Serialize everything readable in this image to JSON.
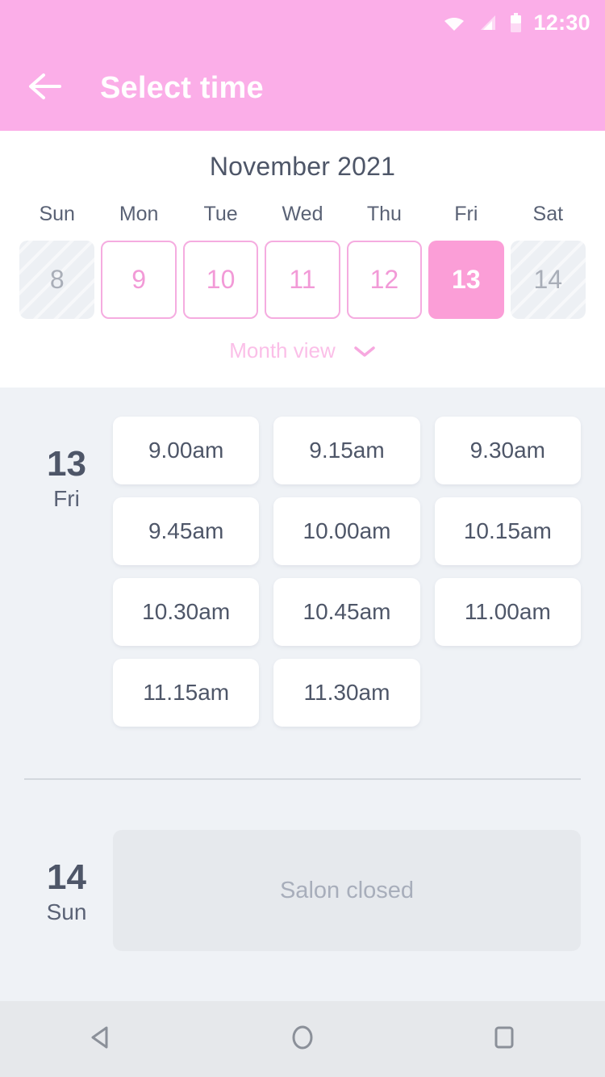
{
  "status_bar": {
    "time": "12:30",
    "icons": [
      "wifi-icon",
      "signal-icon",
      "battery-icon"
    ]
  },
  "app_bar": {
    "title": "Select time",
    "back_icon": "back-arrow-icon"
  },
  "calendar": {
    "month_title": "November 2021",
    "day_names": [
      "Sun",
      "Mon",
      "Tue",
      "Wed",
      "Thu",
      "Fri",
      "Sat"
    ],
    "dates": [
      {
        "day": "8",
        "state": "disabled"
      },
      {
        "day": "9",
        "state": "enabled"
      },
      {
        "day": "10",
        "state": "enabled"
      },
      {
        "day": "11",
        "state": "enabled"
      },
      {
        "day": "12",
        "state": "enabled"
      },
      {
        "day": "13",
        "state": "selected"
      },
      {
        "day": "14",
        "state": "disabled"
      }
    ],
    "month_view_label": "Month view",
    "month_view_chevron": "chevron-down-icon"
  },
  "slots_section": {
    "days": [
      {
        "day_number": "13",
        "day_name": "Fri",
        "slots": [
          "9.00am",
          "9.15am",
          "9.30am",
          "9.45am",
          "10.00am",
          "10.15am",
          "10.30am",
          "10.45am",
          "11.00am",
          "11.15am",
          "11.30am"
        ],
        "closed_message": null
      },
      {
        "day_number": "14",
        "day_name": "Sun",
        "slots": [],
        "closed_message": "Salon closed"
      }
    ]
  },
  "nav_bar": {
    "back_label": "back-triangle-icon",
    "home_label": "home-circle-icon",
    "recents_label": "recents-square-icon"
  },
  "colors": {
    "brand_pink": "#fbaee8",
    "selected_pink": "#fb9ed7",
    "border_pink": "#f5ace0",
    "text_slate": "#4e5668",
    "section_bg": "#eff2f6",
    "closed_bg": "#e6e9ed"
  }
}
